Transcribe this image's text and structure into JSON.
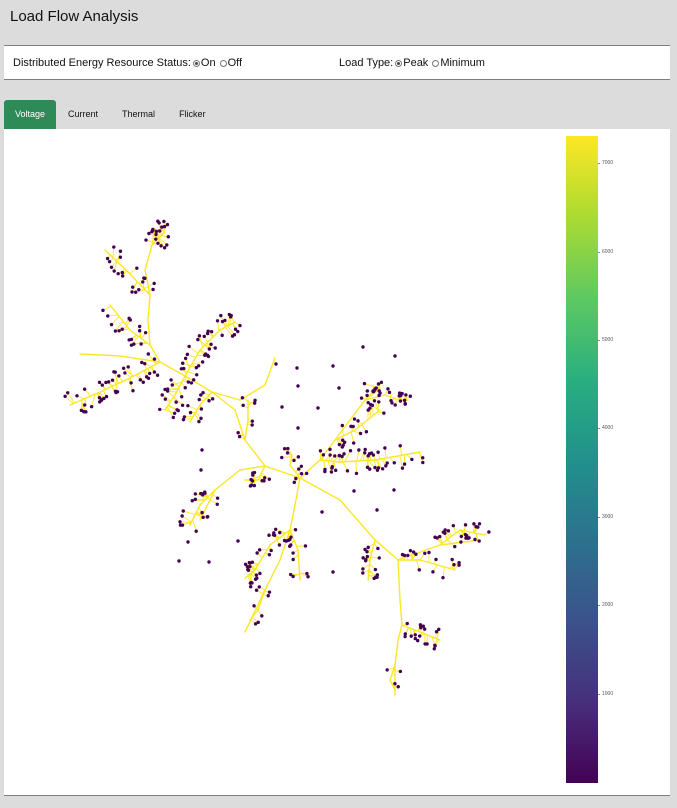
{
  "app": {
    "title": "Load Flow Analysis"
  },
  "controls": {
    "der": {
      "label": "Distributed Energy Resource Status:",
      "options": [
        {
          "label": "On",
          "checked": true
        },
        {
          "label": "Off",
          "checked": false
        }
      ]
    },
    "load": {
      "label": "Load Type:",
      "options": [
        {
          "label": "Peak",
          "checked": true
        },
        {
          "label": "Minimum",
          "checked": false
        }
      ]
    }
  },
  "tabs": [
    {
      "label": "Voltage",
      "active": true
    },
    {
      "label": "Current",
      "active": false
    },
    {
      "label": "Thermal",
      "active": false
    },
    {
      "label": "Flicker",
      "active": false
    }
  ],
  "colorbar": {
    "colormap": "viridis",
    "min_color": "#440154",
    "max_color": "#fde725",
    "range": [
      0,
      7300
    ],
    "ticks": [
      "7000",
      "6000",
      "5000",
      "4000",
      "3000",
      "2000",
      "1000"
    ]
  },
  "network": {
    "line_color": "#fde725",
    "node_color": "#440154"
  }
}
